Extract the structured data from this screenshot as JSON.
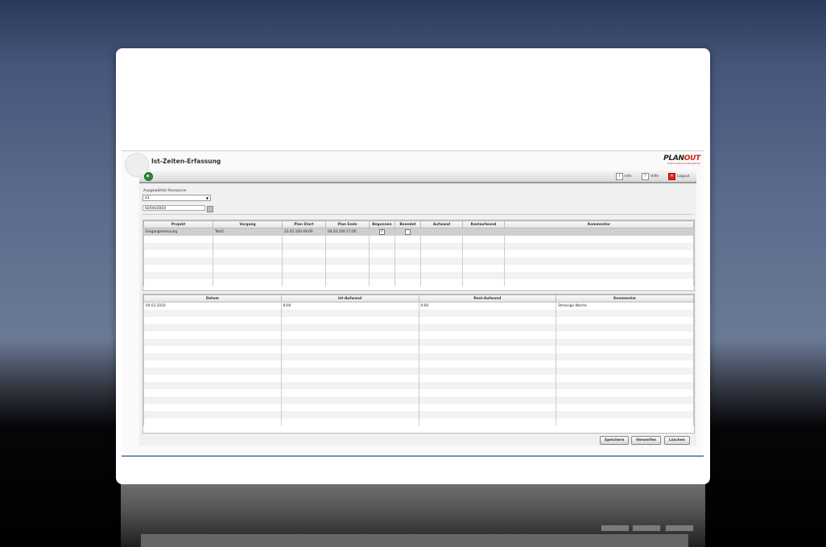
{
  "app": {
    "title": "Ist-Zeiten-Erfassung",
    "brand_plan": "PLAN",
    "brand_out": "OUT",
    "brand_tagline": "Project & Resource Management"
  },
  "toolbar": {
    "info": "Info",
    "help": "Hilfe",
    "logout": "Logout"
  },
  "resource": {
    "label": "Ausgewählte Ressource",
    "value": "e1",
    "date": "02/04/2010"
  },
  "top_table": {
    "headers": [
      "Projekt",
      "Vorgang",
      "Plan Start",
      "Plan Ende",
      "Begonnen",
      "Beendet",
      "Aufwand",
      "Restaufwand",
      "Kommentar"
    ],
    "row1": {
      "projekt": "Eingangsmessung",
      "vorgang": "Test1",
      "plan_start": "23.01.100 09:00",
      "plan_ende": "04.02.100 17:00",
      "aufwand": "",
      "restaufwand": "",
      "kommentar": ""
    }
  },
  "bottom_table": {
    "headers": [
      "Datum",
      "Ist-Aufwand",
      "Rest-Aufwand",
      "Kommentar"
    ],
    "row1": {
      "datum": "04.02.2010",
      "ist": "8:00",
      "rest": "0:00",
      "kommentar": "Stressige Woche"
    }
  },
  "buttons": {
    "save": "Speichern",
    "discard": "Verwerfen",
    "delete": "Löschen"
  },
  "colors": {
    "brand_red": "#c82020",
    "refresh_green": "#2a8a3a"
  }
}
